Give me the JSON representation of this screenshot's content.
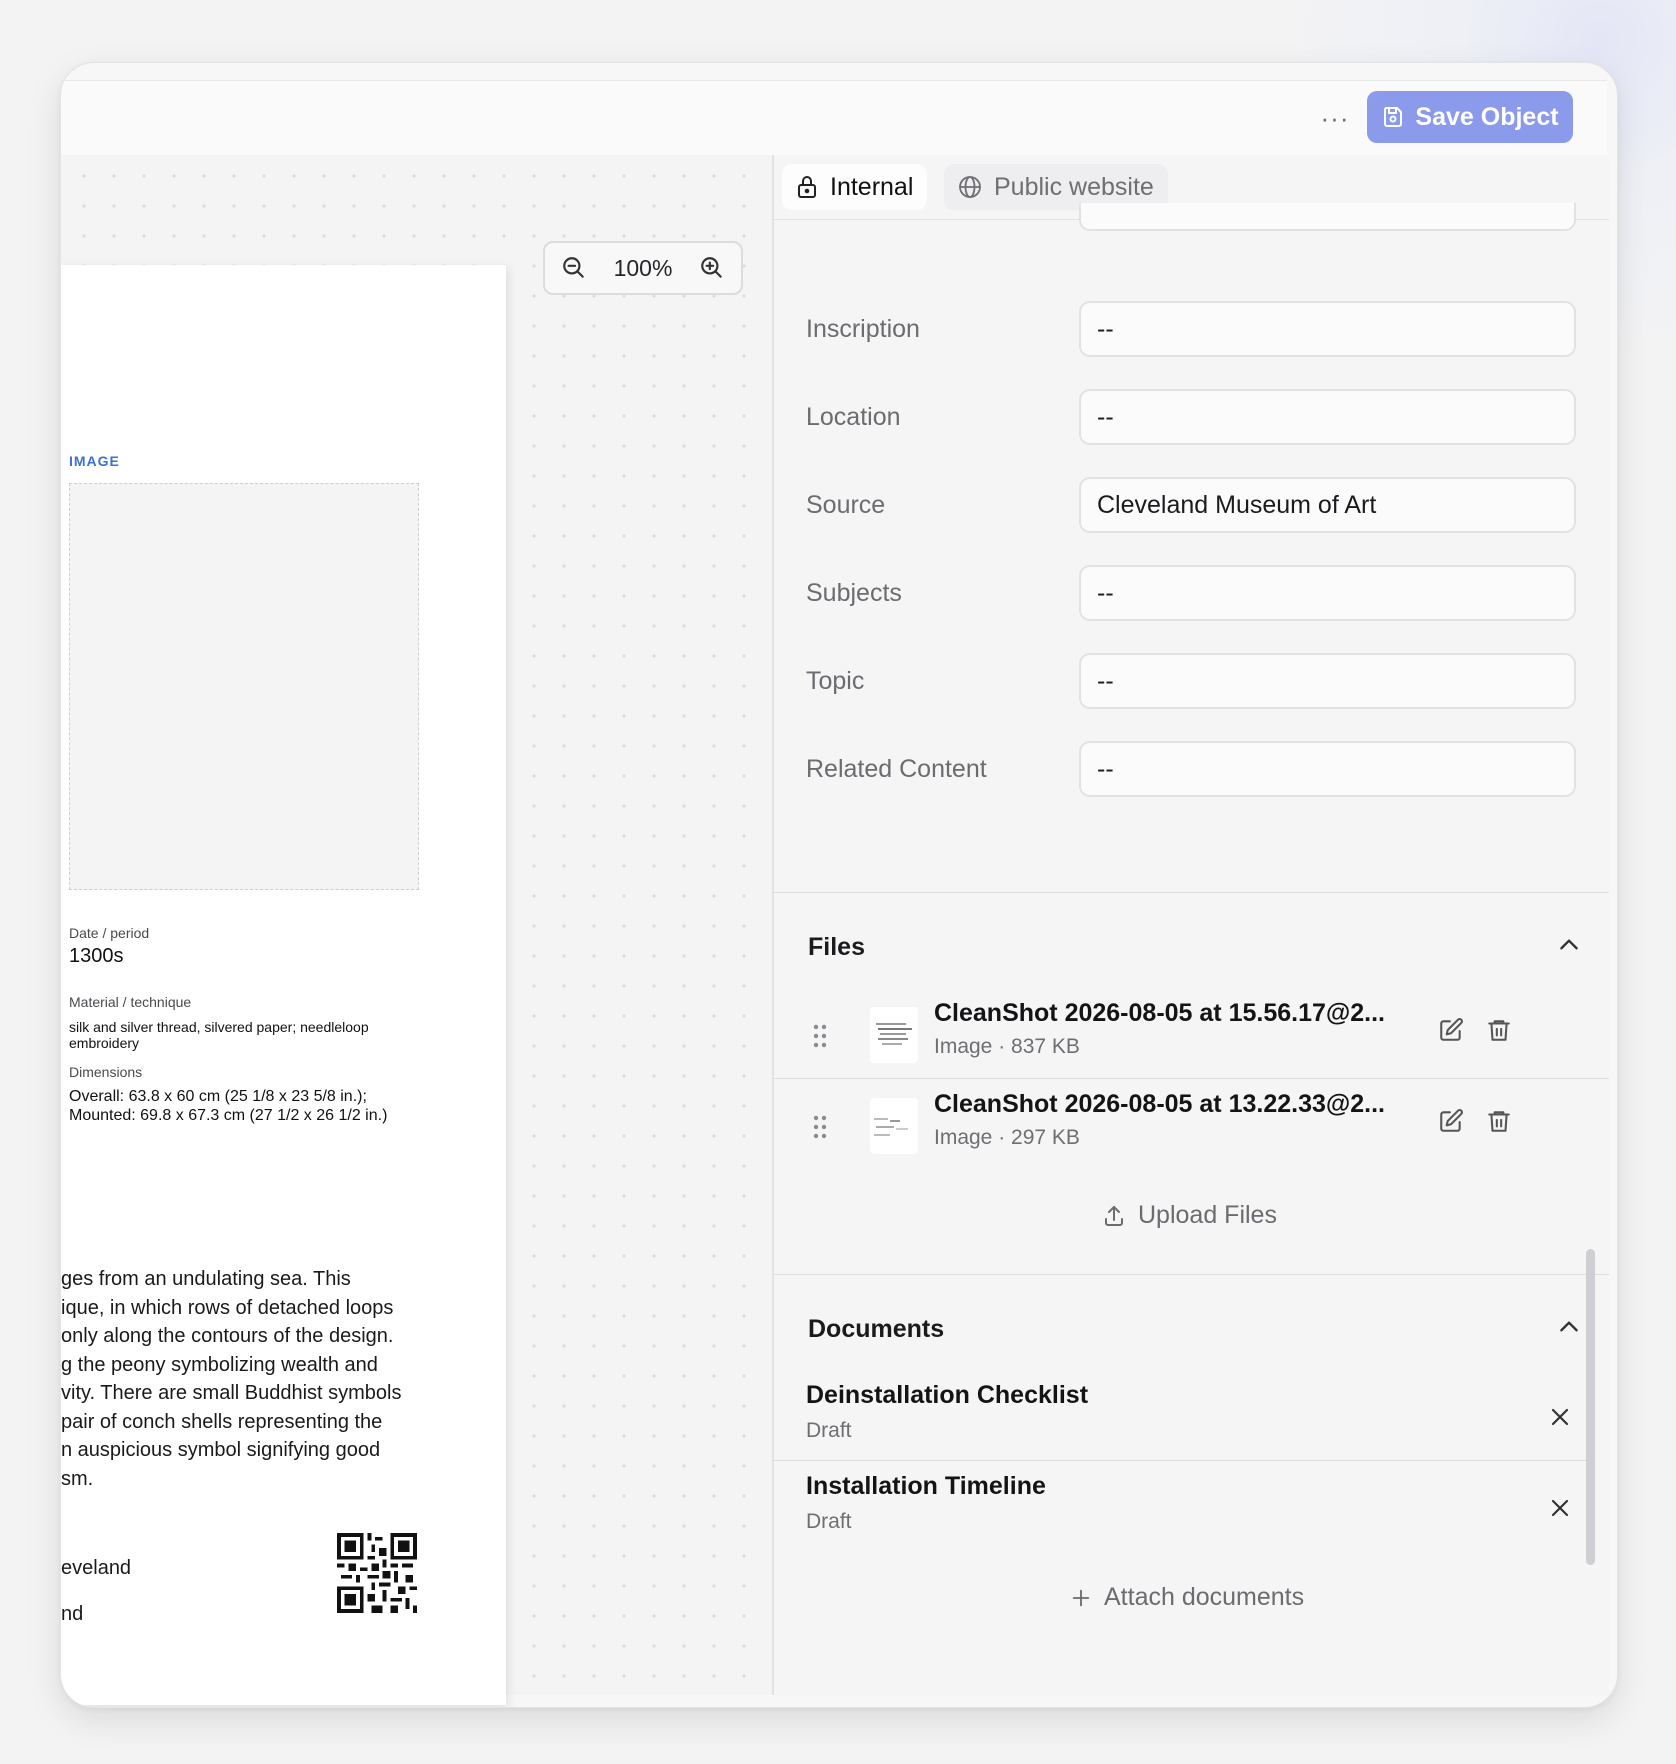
{
  "toolbar": {
    "more_label": "···",
    "save_label": "Save Object"
  },
  "zoom": {
    "level": "100%"
  },
  "label_card": {
    "image_heading": "IMAGE",
    "date_label": "Date / period",
    "date_value": "1300s",
    "material_label": "Material / technique",
    "material_line1": "silk and silver thread, silvered paper; needleloop",
    "material_line2": "embroidery",
    "dimensions_label": "Dimensions",
    "dimensions_line1": "Overall: 63.8 x 60 cm (25 1/8 x 23 5/8 in.);",
    "dimensions_line2": "Mounted: 69.8 x 67.3 cm (27 1/2 x 26 1/2 in.)",
    "description_lines": [
      "ges from an undulating sea. This",
      "ique, in which rows of detached loops",
      " only along the contours of the design.",
      "g the peony symbolizing wealth and",
      "vity. There are small Buddhist symbols",
      "pair of conch shells representing the",
      "n auspicious symbol signifying good",
      "sm."
    ],
    "credit_line1": "eveland",
    "credit_line2": "nd"
  },
  "tabs": [
    {
      "label": "Internal",
      "icon": "lock-icon"
    },
    {
      "label": "Public website",
      "icon": "globe-icon"
    }
  ],
  "fields": [
    {
      "label": "Inscription",
      "value": "--"
    },
    {
      "label": "Location",
      "value": "--"
    },
    {
      "label": "Source",
      "value": "Cleveland Museum of Art"
    },
    {
      "label": "Subjects",
      "value": "--"
    },
    {
      "label": "Topic",
      "value": "--"
    },
    {
      "label": "Related Content",
      "value": "--"
    }
  ],
  "files": {
    "title": "Files",
    "items": [
      {
        "name": "CleanShot 2026-08-05 at 15.56.17@2...",
        "meta": "Image · 837 KB"
      },
      {
        "name": "CleanShot 2026-08-05 at 13.22.33@2...",
        "meta": "Image · 297 KB"
      }
    ],
    "upload_label": "Upload Files"
  },
  "documents": {
    "title": "Documents",
    "items": [
      {
        "title": "Deinstallation Checklist",
        "status": "Draft"
      },
      {
        "title": "Installation Timeline",
        "status": "Draft"
      }
    ],
    "attach_label": "Attach documents"
  },
  "colors": {
    "accent": "#8b9aea",
    "link": "#3f6fd1"
  }
}
